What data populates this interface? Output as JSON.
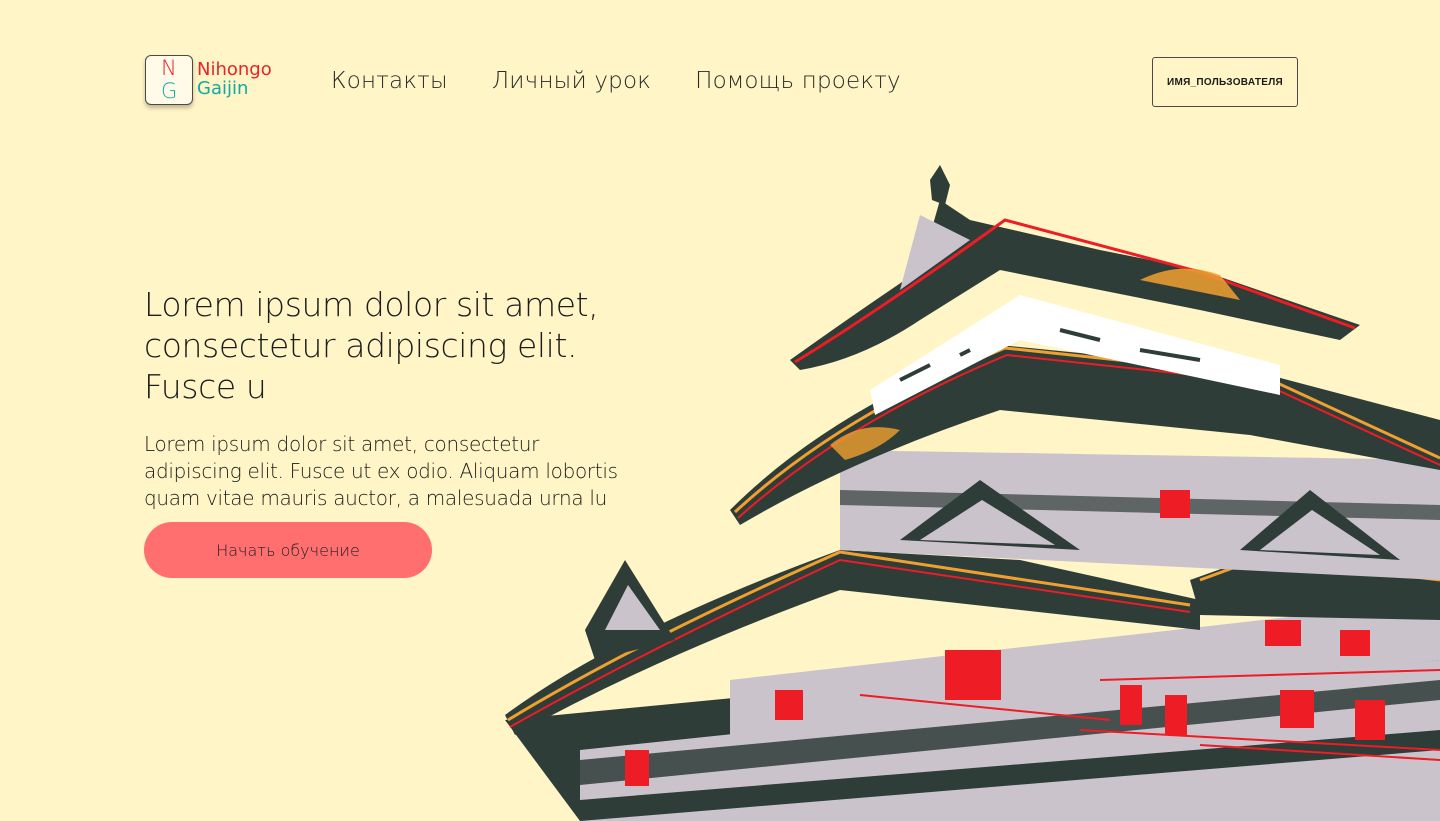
{
  "header": {
    "logo": {
      "mark_top": "N",
      "mark_bottom": "G",
      "line1": "Nihongo",
      "line2": "Gaijin"
    },
    "nav": [
      {
        "label": "Контакты"
      },
      {
        "label": "Личный урок"
      },
      {
        "label": "Помощь проекту"
      }
    ],
    "user_button": "ИМЯ_ПОЛЬЗОВАТЕЛЯ"
  },
  "hero": {
    "title_lines": [
      "Lorem ipsum dolor sit amet,",
      "consectetur adipiscing elit.",
      "Fusce u"
    ],
    "subtitle_lines": [
      "Lorem ipsum dolor sit amet, consectetur",
      "adipiscing elit. Fusce ut ex odio. Aliquam lobortis",
      "quam vitae mauris auctor, a malesuada urna lu"
    ],
    "cta_label": "Начать обучение"
  },
  "colors": {
    "background": "#fff5c6",
    "logo_red": "#e8242a",
    "logo_teal": "#10aaa2",
    "cta": "#ff6f6f",
    "castle_roof": "#2f3d38",
    "castle_wall": "#cbc3cc",
    "castle_accent": "#ee1c24",
    "castle_gold": "#f0a030"
  },
  "illustration": {
    "icon": "japanese-castle-illustration"
  }
}
